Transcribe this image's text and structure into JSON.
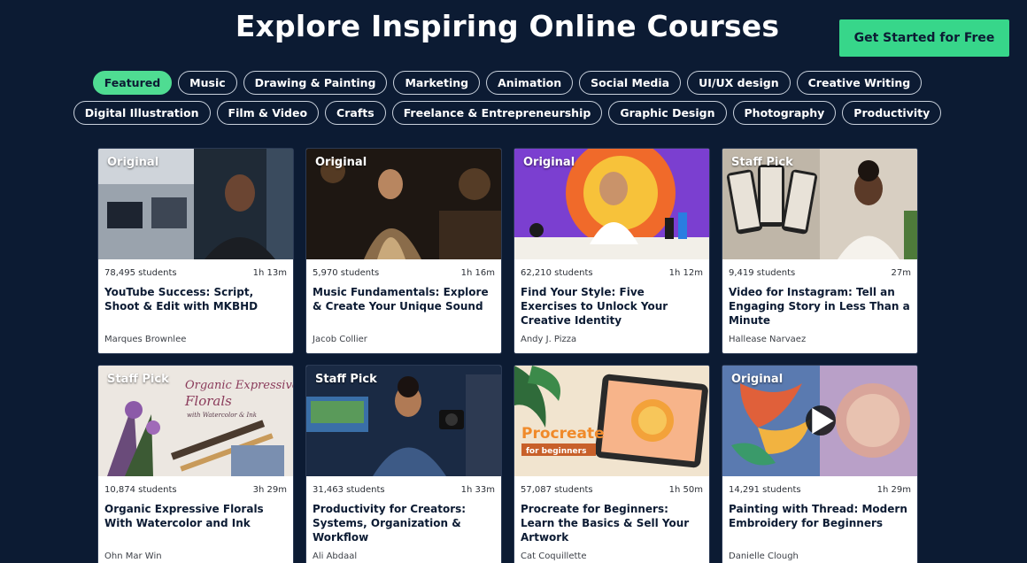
{
  "header": {
    "title": "Explore Inspiring Online Courses",
    "cta_label": "Get Started for Free"
  },
  "filters": {
    "row1": [
      "Featured",
      "Music",
      "Drawing & Painting",
      "Marketing",
      "Animation",
      "Social Media",
      "UI/UX design",
      "Creative Writing"
    ],
    "row2": [
      "Digital Illustration",
      "Film & Video",
      "Crafts",
      "Freelance & Entrepreneurship",
      "Graphic Design",
      "Photography",
      "Productivity"
    ],
    "active": "Featured"
  },
  "courses": [
    {
      "badge": "Original",
      "students": "78,495 students",
      "duration": "1h 13m",
      "title": "YouTube Success: Script, Shoot & Edit with MKBHD",
      "author": "Marques Brownlee"
    },
    {
      "badge": "Original",
      "students": "5,970 students",
      "duration": "1h 16m",
      "title": "Music Fundamentals: Explore & Create Your Unique Sound",
      "author": "Jacob Collier"
    },
    {
      "badge": "Original",
      "students": "62,210 students",
      "duration": "1h 12m",
      "title": "Find Your Style: Five Exercises to Unlock Your Creative Identity",
      "author": "Andy J. Pizza"
    },
    {
      "badge": "Staff Pick",
      "students": "9,419 students",
      "duration": "27m",
      "title": "Video for Instagram: Tell an Engaging Story in Less Than a Minute",
      "author": "Hallease Narvaez"
    },
    {
      "badge": "Staff Pick",
      "students": "10,874 students",
      "duration": "3h 29m",
      "title": "Organic Expressive Florals With Watercolor and Ink",
      "author": "Ohn Mar Win"
    },
    {
      "badge": "Staff Pick",
      "students": "31,463 students",
      "duration": "1h 33m",
      "title": "Productivity for Creators: Systems, Organization & Workflow",
      "author": "Ali Abdaal"
    },
    {
      "badge": "",
      "students": "57,087 students",
      "duration": "1h 50m",
      "title": "Procreate for Beginners: Learn the Basics & Sell Your Artwork",
      "author": "Cat Coquillette"
    },
    {
      "badge": "Original",
      "students": "14,291 students",
      "duration": "1h 29m",
      "title": "Painting with Thread: Modern Embroidery for Beginners",
      "author": "Danielle Clough"
    }
  ],
  "thumbnail_text": {
    "florals_line1": "Organic Expressive",
    "florals_line2": "Florals",
    "florals_line3": "with Watercolor & Ink",
    "procreate_title": "Procreate",
    "procreate_sub": "for beginners"
  },
  "colors": {
    "background": "#0c1b33",
    "accent": "#37d68a",
    "chip_active": "#4fdc92"
  }
}
